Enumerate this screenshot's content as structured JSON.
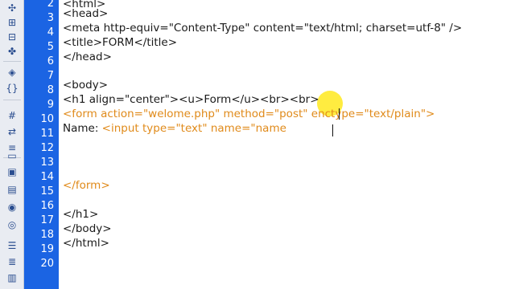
{
  "toolbar": {
    "icons": [
      "expand-icon",
      "code-collapse-icon",
      "collapse-selection-icon",
      "expand-all-icon",
      "select-parent-icon",
      "balance-braces-icon",
      "line-numbers-icon",
      "highlight-invalid-icon",
      "syntax-coloring-icon",
      "apply-comment-icon",
      "remove-comment-icon",
      "wrap-tag-icon",
      "recent-snippets-icon",
      "move-css-icon",
      "indent-icon",
      "outdent-icon",
      "format-source-icon"
    ]
  },
  "gutter": {
    "line_numbers": [
      "2",
      "3",
      "4",
      "5",
      "6",
      "7",
      "8",
      "9",
      "10",
      "11",
      "12",
      "13",
      "14",
      "15",
      "16",
      "17",
      "18",
      "19",
      "20"
    ]
  },
  "code": {
    "line2": "<html>",
    "line3": "<head>",
    "line4": "<meta http-equiv=\"Content-Type\" content=\"text/html; charset=utf-8\" />",
    "line5a": "<title>",
    "line5b": "FORM",
    "line5c": "</title>",
    "line6": "</head>",
    "line7": "",
    "line8": "<body>",
    "line9a": "<h1 align=\"center\"><u>",
    "line9b": "Form",
    "line9c": "</u><br><br>",
    "line10": "<form action=\"welome.php\" method=\"post\" enctype=\"text/plain\">",
    "line11a": "Name: ",
    "line11b": "<input type=\"text\" name=\"name",
    "line15": "</form>",
    "line17": "</h1>",
    "line18": "</body>",
    "line19": "</html>"
  },
  "colors": {
    "gutter": "#1b64e3",
    "form_tag": "#e08a1a",
    "highlight": "#ffe600"
  }
}
